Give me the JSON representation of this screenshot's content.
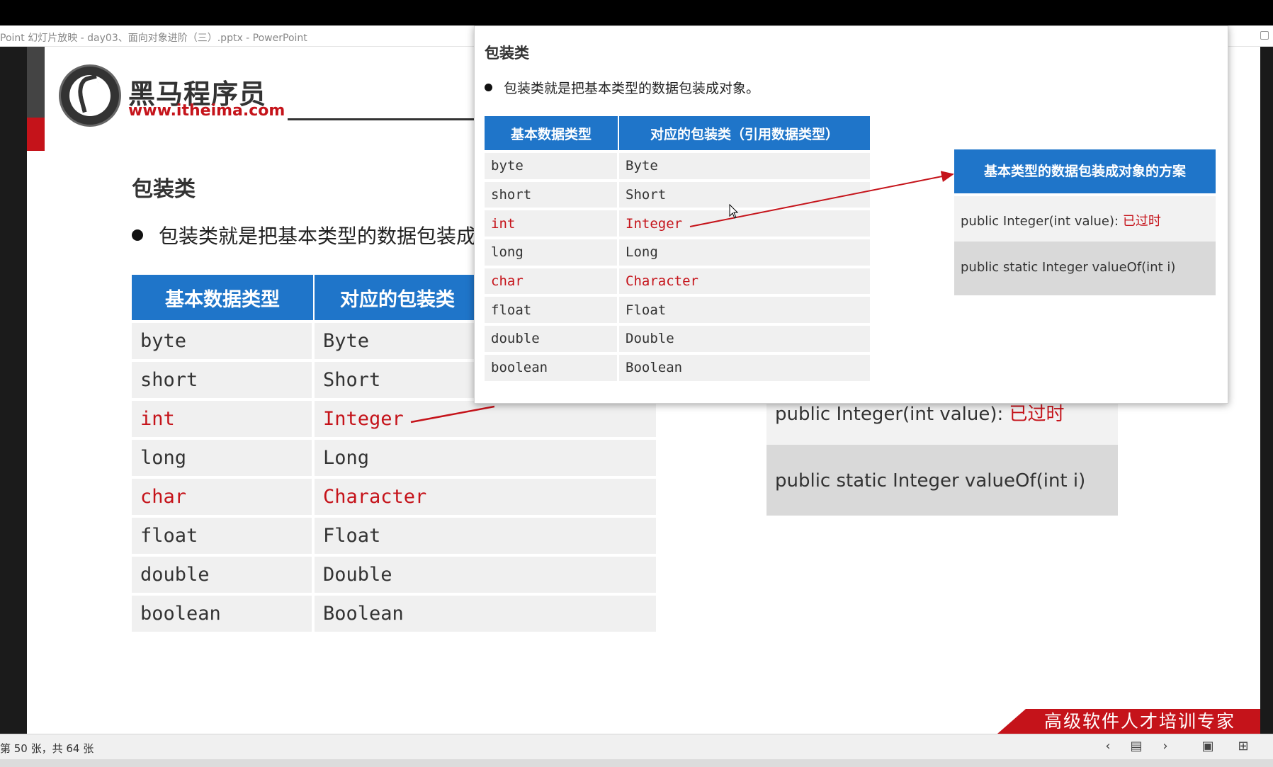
{
  "window": {
    "title": "Point 幻灯片放映 - day03、面向对象进阶（三）.pptx - PowerPoint"
  },
  "slide": {
    "brand_name": "黑马程序员",
    "brand_url": "www.itheima.com",
    "title": "包装类",
    "bullet": "包装类就是把基本类型的数据包装成对象。",
    "table": {
      "headers": [
        "基本数据类型",
        "对应的包装类（引用数据类型）"
      ],
      "rows": [
        {
          "primitive": "byte",
          "wrapper": "Byte",
          "highlight": false
        },
        {
          "primitive": "short",
          "wrapper": "Short",
          "highlight": false
        },
        {
          "primitive": "int",
          "wrapper": "Integer",
          "highlight": true
        },
        {
          "primitive": "long",
          "wrapper": "Long",
          "highlight": false
        },
        {
          "primitive": "char",
          "wrapper": "Character",
          "highlight": true
        },
        {
          "primitive": "float",
          "wrapper": "Float",
          "highlight": false
        },
        {
          "primitive": "double",
          "wrapper": "Double",
          "highlight": false
        },
        {
          "primitive": "boolean",
          "wrapper": "Boolean",
          "highlight": false
        }
      ]
    },
    "bg_table_headers_visible": [
      "基本数据类型",
      "对应的包装类"
    ],
    "bg_table_bullet_visible": "包装类就是把基本类型的数据包装成",
    "scheme": {
      "title": "基本类型的数据包装成对象的方案",
      "option1_code": "public Integer(int value)",
      "option1_sep": ":  ",
      "option1_note": "已过时",
      "option2_code": "public static Integer valueOf(int i)"
    },
    "slogan": "高级软件人才培训专家"
  },
  "statusbar": {
    "slide_info": "第 50 张，共 64 张",
    "prev_label": "‹",
    "next_label": "›",
    "reading_view_label": "▤",
    "normal_view_label": "▣",
    "sorter_view_label": "⊞"
  },
  "colors": {
    "accent_blue": "#1f75c9",
    "accent_red": "#c5131a",
    "row_bg": "#f0f0f0",
    "option2_bg": "#d9d9d9"
  },
  "icons": [
    "restore-window-icon",
    "logo-horse-icon",
    "prev-slide-icon",
    "next-slide-icon",
    "reading-view-icon",
    "normal-view-icon",
    "slide-sorter-icon",
    "mouse-cursor-icon"
  ]
}
